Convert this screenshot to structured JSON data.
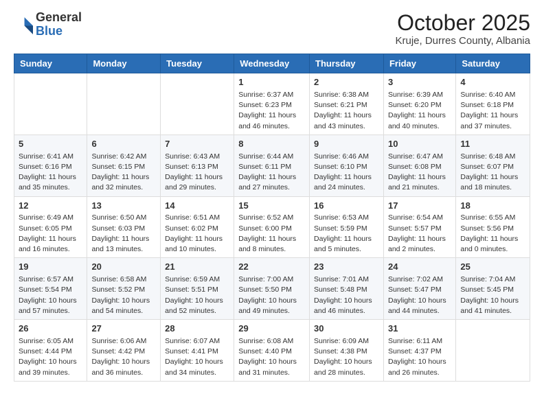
{
  "logo": {
    "line1": "General",
    "line2": "Blue"
  },
  "title": "October 2025",
  "subtitle": "Kruje, Durres County, Albania",
  "days_of_week": [
    "Sunday",
    "Monday",
    "Tuesday",
    "Wednesday",
    "Thursday",
    "Friday",
    "Saturday"
  ],
  "weeks": [
    [
      {
        "day": "",
        "info": ""
      },
      {
        "day": "",
        "info": ""
      },
      {
        "day": "",
        "info": ""
      },
      {
        "day": "1",
        "info": "Sunrise: 6:37 AM\nSunset: 6:23 PM\nDaylight: 11 hours and 46 minutes."
      },
      {
        "day": "2",
        "info": "Sunrise: 6:38 AM\nSunset: 6:21 PM\nDaylight: 11 hours and 43 minutes."
      },
      {
        "day": "3",
        "info": "Sunrise: 6:39 AM\nSunset: 6:20 PM\nDaylight: 11 hours and 40 minutes."
      },
      {
        "day": "4",
        "info": "Sunrise: 6:40 AM\nSunset: 6:18 PM\nDaylight: 11 hours and 37 minutes."
      }
    ],
    [
      {
        "day": "5",
        "info": "Sunrise: 6:41 AM\nSunset: 6:16 PM\nDaylight: 11 hours and 35 minutes."
      },
      {
        "day": "6",
        "info": "Sunrise: 6:42 AM\nSunset: 6:15 PM\nDaylight: 11 hours and 32 minutes."
      },
      {
        "day": "7",
        "info": "Sunrise: 6:43 AM\nSunset: 6:13 PM\nDaylight: 11 hours and 29 minutes."
      },
      {
        "day": "8",
        "info": "Sunrise: 6:44 AM\nSunset: 6:11 PM\nDaylight: 11 hours and 27 minutes."
      },
      {
        "day": "9",
        "info": "Sunrise: 6:46 AM\nSunset: 6:10 PM\nDaylight: 11 hours and 24 minutes."
      },
      {
        "day": "10",
        "info": "Sunrise: 6:47 AM\nSunset: 6:08 PM\nDaylight: 11 hours and 21 minutes."
      },
      {
        "day": "11",
        "info": "Sunrise: 6:48 AM\nSunset: 6:07 PM\nDaylight: 11 hours and 18 minutes."
      }
    ],
    [
      {
        "day": "12",
        "info": "Sunrise: 6:49 AM\nSunset: 6:05 PM\nDaylight: 11 hours and 16 minutes."
      },
      {
        "day": "13",
        "info": "Sunrise: 6:50 AM\nSunset: 6:03 PM\nDaylight: 11 hours and 13 minutes."
      },
      {
        "day": "14",
        "info": "Sunrise: 6:51 AM\nSunset: 6:02 PM\nDaylight: 11 hours and 10 minutes."
      },
      {
        "day": "15",
        "info": "Sunrise: 6:52 AM\nSunset: 6:00 PM\nDaylight: 11 hours and 8 minutes."
      },
      {
        "day": "16",
        "info": "Sunrise: 6:53 AM\nSunset: 5:59 PM\nDaylight: 11 hours and 5 minutes."
      },
      {
        "day": "17",
        "info": "Sunrise: 6:54 AM\nSunset: 5:57 PM\nDaylight: 11 hours and 2 minutes."
      },
      {
        "day": "18",
        "info": "Sunrise: 6:55 AM\nSunset: 5:56 PM\nDaylight: 11 hours and 0 minutes."
      }
    ],
    [
      {
        "day": "19",
        "info": "Sunrise: 6:57 AM\nSunset: 5:54 PM\nDaylight: 10 hours and 57 minutes."
      },
      {
        "day": "20",
        "info": "Sunrise: 6:58 AM\nSunset: 5:52 PM\nDaylight: 10 hours and 54 minutes."
      },
      {
        "day": "21",
        "info": "Sunrise: 6:59 AM\nSunset: 5:51 PM\nDaylight: 10 hours and 52 minutes."
      },
      {
        "day": "22",
        "info": "Sunrise: 7:00 AM\nSunset: 5:50 PM\nDaylight: 10 hours and 49 minutes."
      },
      {
        "day": "23",
        "info": "Sunrise: 7:01 AM\nSunset: 5:48 PM\nDaylight: 10 hours and 46 minutes."
      },
      {
        "day": "24",
        "info": "Sunrise: 7:02 AM\nSunset: 5:47 PM\nDaylight: 10 hours and 44 minutes."
      },
      {
        "day": "25",
        "info": "Sunrise: 7:04 AM\nSunset: 5:45 PM\nDaylight: 10 hours and 41 minutes."
      }
    ],
    [
      {
        "day": "26",
        "info": "Sunrise: 6:05 AM\nSunset: 4:44 PM\nDaylight: 10 hours and 39 minutes."
      },
      {
        "day": "27",
        "info": "Sunrise: 6:06 AM\nSunset: 4:42 PM\nDaylight: 10 hours and 36 minutes."
      },
      {
        "day": "28",
        "info": "Sunrise: 6:07 AM\nSunset: 4:41 PM\nDaylight: 10 hours and 34 minutes."
      },
      {
        "day": "29",
        "info": "Sunrise: 6:08 AM\nSunset: 4:40 PM\nDaylight: 10 hours and 31 minutes."
      },
      {
        "day": "30",
        "info": "Sunrise: 6:09 AM\nSunset: 4:38 PM\nDaylight: 10 hours and 28 minutes."
      },
      {
        "day": "31",
        "info": "Sunrise: 6:11 AM\nSunset: 4:37 PM\nDaylight: 10 hours and 26 minutes."
      },
      {
        "day": "",
        "info": ""
      }
    ]
  ]
}
